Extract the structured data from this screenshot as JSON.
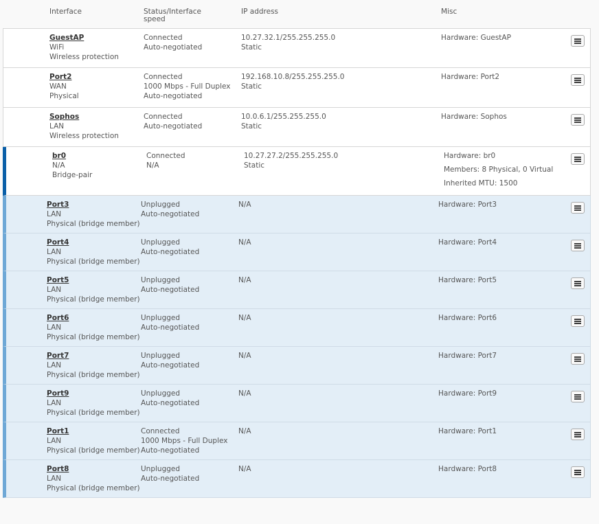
{
  "header": {
    "interface": "Interface",
    "status": "Status/Interface speed",
    "ip": "IP address",
    "misc": "Misc"
  },
  "rows": [
    {
      "name": "GuestAP",
      "type": "WiFi",
      "kind": "Wireless protection",
      "status": [
        "Connected",
        "Auto-negotiated"
      ],
      "ip": [
        "10.27.32.1/255.255.255.0",
        "Static"
      ],
      "misc": [
        "Hardware:  GuestAP"
      ]
    },
    {
      "name": "Port2",
      "type": "WAN",
      "kind": "Physical",
      "status": [
        "Connected",
        "1000 Mbps - Full Duplex",
        "Auto-negotiated"
      ],
      "ip": [
        "192.168.10.8/255.255.255.0",
        "Static"
      ],
      "misc": [
        "Hardware:  Port2"
      ]
    },
    {
      "name": "Sophos",
      "type": "LAN",
      "kind": "Wireless protection",
      "status": [
        "Connected",
        "Auto-negotiated"
      ],
      "ip": [
        "10.0.6.1/255.255.255.0",
        "Static"
      ],
      "misc": [
        "Hardware:  Sophos"
      ]
    },
    {
      "name": "br0",
      "type": "N/A",
      "kind": "Bridge-pair",
      "status": [
        "Connected",
        "N/A"
      ],
      "ip": [
        "10.27.27.2/255.255.255.0",
        "Static"
      ],
      "misc": [
        "Hardware:  br0",
        "Members: 8 Physical, 0 Virtual",
        "Inherited MTU: 1500"
      ]
    },
    {
      "name": "Port3",
      "type": "LAN",
      "kind": "Physical (bridge member)",
      "status": [
        "Unplugged",
        "Auto-negotiated"
      ],
      "ip": [
        "N/A"
      ],
      "misc": [
        "Hardware:  Port3"
      ]
    },
    {
      "name": "Port4",
      "type": "LAN",
      "kind": "Physical (bridge member)",
      "status": [
        "Unplugged",
        "Auto-negotiated"
      ],
      "ip": [
        "N/A"
      ],
      "misc": [
        "Hardware:  Port4"
      ]
    },
    {
      "name": "Port5",
      "type": "LAN",
      "kind": "Physical (bridge member)",
      "status": [
        "Unplugged",
        "Auto-negotiated"
      ],
      "ip": [
        "N/A"
      ],
      "misc": [
        "Hardware:  Port5"
      ]
    },
    {
      "name": "Port6",
      "type": "LAN",
      "kind": "Physical (bridge member)",
      "status": [
        "Unplugged",
        "Auto-negotiated"
      ],
      "ip": [
        "N/A"
      ],
      "misc": [
        "Hardware:  Port6"
      ]
    },
    {
      "name": "Port7",
      "type": "LAN",
      "kind": "Physical (bridge member)",
      "status": [
        "Unplugged",
        "Auto-negotiated"
      ],
      "ip": [
        "N/A"
      ],
      "misc": [
        "Hardware:  Port7"
      ]
    },
    {
      "name": "Port9",
      "type": "LAN",
      "kind": "Physical (bridge member)",
      "status": [
        "Unplugged",
        "Auto-negotiated"
      ],
      "ip": [
        "N/A"
      ],
      "misc": [
        "Hardware:  Port9"
      ]
    },
    {
      "name": "Port1",
      "type": "LAN",
      "kind": "Physical (bridge member)",
      "status": [
        "Connected",
        "1000 Mbps - Full Duplex",
        "Auto-negotiated"
      ],
      "ip": [
        "N/A"
      ],
      "misc": [
        "Hardware:  Port1"
      ]
    },
    {
      "name": "Port8",
      "type": "LAN",
      "kind": "Physical (bridge member)",
      "status": [
        "Unplugged",
        "Auto-negotiated"
      ],
      "ip": [
        "N/A"
      ],
      "misc": [
        "Hardware:  Port8"
      ]
    }
  ]
}
